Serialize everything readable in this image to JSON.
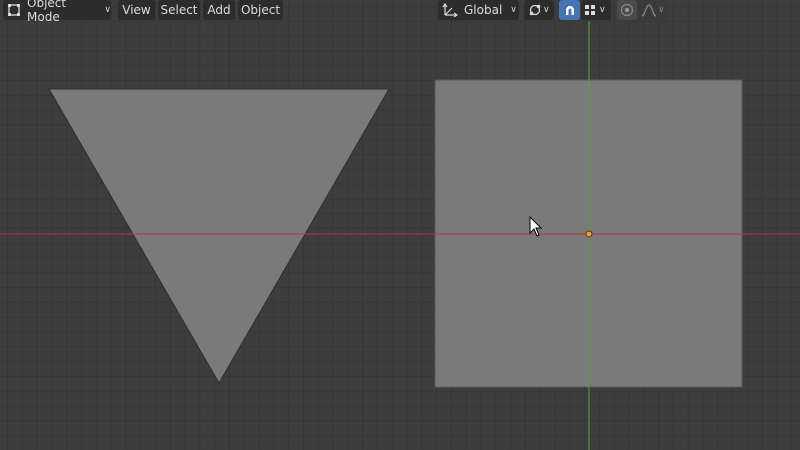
{
  "header": {
    "mode_label": "Object Mode",
    "menu": [
      "View",
      "Select",
      "Add",
      "Object"
    ],
    "transform_orientation": "Global"
  },
  "icons": {
    "mode": "object-mode-icon",
    "orientation": "transform-orientation-icon",
    "pivot": "pivot-point-icon",
    "snap": "snap-magnet-icon",
    "snap_target": "snap-increment-icon",
    "proportional": "proportional-editing-icon",
    "falloff": "falloff-curve-icon",
    "cursor": "mouse-pointer-icon"
  },
  "colors": {
    "viewport_bg": "#3d3d3d",
    "grid": "#363636",
    "mesh_fill": "#7a7a7a",
    "x_axis": "#b03c3c",
    "y_axis": "#6a9a22",
    "origin": "#f0a030",
    "snap_active": "#4772b3"
  }
}
